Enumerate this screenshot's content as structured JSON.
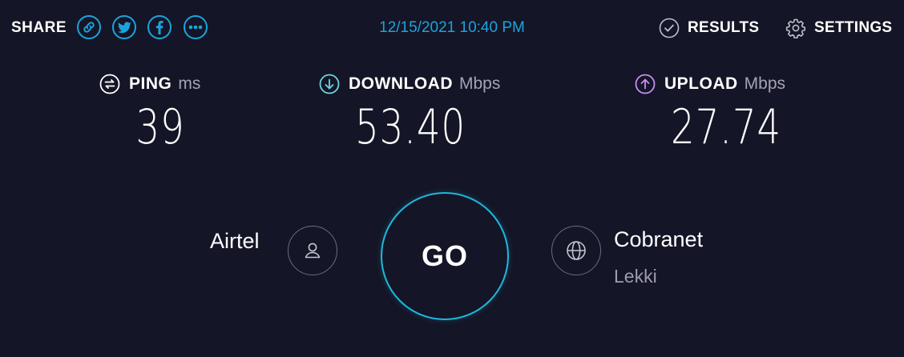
{
  "header": {
    "share_label": "SHARE",
    "share_icons": [
      "link-icon",
      "twitter-icon",
      "facebook-icon",
      "more-icon"
    ],
    "datetime": "12/15/2021 10:40 PM",
    "results_label": "RESULTS",
    "settings_label": "SETTINGS"
  },
  "metrics": {
    "ping": {
      "label": "PING",
      "unit": "ms",
      "value": "39"
    },
    "download": {
      "label": "DOWNLOAD",
      "unit": "Mbps",
      "value": "53.40"
    },
    "upload": {
      "label": "UPLOAD",
      "unit": "Mbps",
      "value": "27.74"
    }
  },
  "connection": {
    "isp": "Airtel",
    "go_label": "GO",
    "server_name": "Cobranet",
    "server_location": "Lekki"
  },
  "colors": {
    "background": "#141526",
    "accent_blue": "#1ca3dd",
    "download_icon": "#6fd3e3",
    "upload_icon": "#c88df0"
  }
}
